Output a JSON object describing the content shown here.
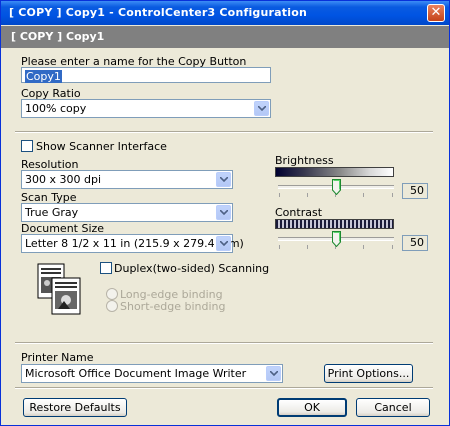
{
  "window": {
    "title": "[ COPY ]  Copy1 - ControlCenter3 Configuration"
  },
  "header": {
    "text": "[ COPY ]  Copy1"
  },
  "copy_name": {
    "label": "Please enter a name for the Copy Button",
    "value": "Copy1"
  },
  "copy_ratio": {
    "label": "Copy Ratio",
    "value": "100% copy"
  },
  "scanner": {
    "show_interface_label": "Show Scanner Interface",
    "show_interface_checked": false
  },
  "resolution": {
    "label": "Resolution",
    "value": "300 x 300 dpi"
  },
  "scan_type": {
    "label": "Scan Type",
    "value": "True Gray"
  },
  "document_size": {
    "label": "Document Size",
    "value": "Letter 8 1/2 x 11 in (215.9 x 279.4 mm)"
  },
  "duplex": {
    "label": "Duplex(two-sided) Scanning",
    "checked": false,
    "long_edge_label": "Long-edge binding",
    "short_edge_label": "Short-edge binding"
  },
  "brightness": {
    "label": "Brightness",
    "value": "50",
    "level": 0.5
  },
  "contrast": {
    "label": "Contrast",
    "value": "50",
    "level": 0.5
  },
  "printer": {
    "label": "Printer Name",
    "value": "Microsoft Office Document Image Writer",
    "options_button": "Print Options..."
  },
  "buttons": {
    "restore": "Restore Defaults",
    "ok": "OK",
    "cancel": "Cancel"
  },
  "colors": {
    "title_bar": "#0054e3",
    "header_band": "#808080",
    "selection": "#316ac5",
    "dialog_bg": "#ece9d8"
  }
}
